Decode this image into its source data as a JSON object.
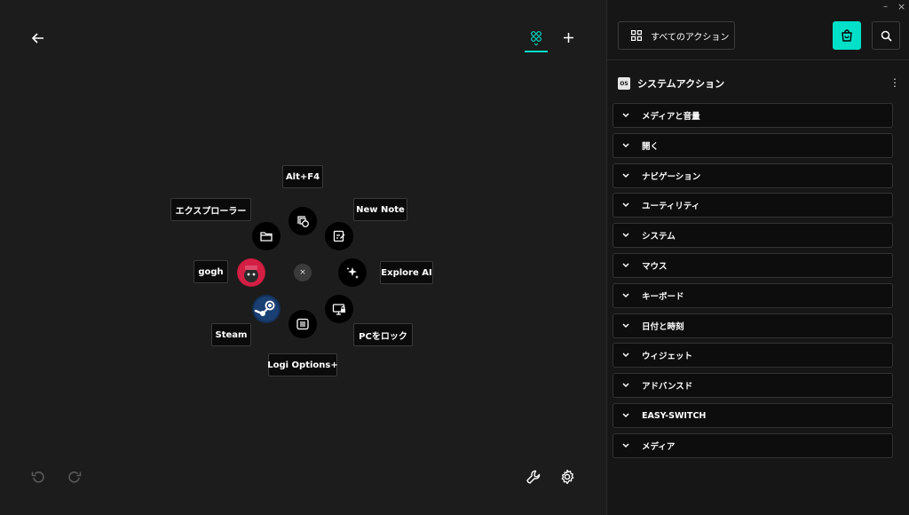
{
  "toolbar": {
    "back_icon": "arrow-left-icon",
    "layout_tab_icon": "grid-icon",
    "add_icon": "plus-icon"
  },
  "radial": {
    "center_close": "×",
    "items": [
      {
        "name": "alt-f4",
        "label": "Alt+F4",
        "icon": "close-window-icon"
      },
      {
        "name": "new-note",
        "label": "New Note",
        "icon": "edit-note-icon"
      },
      {
        "name": "explore-ai",
        "label": "Explore AI",
        "icon": "sparkle-icon"
      },
      {
        "name": "pc-lock",
        "label": "PCをロック",
        "icon": "monitor-lock-icon"
      },
      {
        "name": "logi-options",
        "label": "Logi Options+",
        "icon": "logi-app-icon"
      },
      {
        "name": "steam",
        "label": "Steam",
        "icon": "steam-icon"
      },
      {
        "name": "gogh",
        "label": "gogh",
        "icon": "gogh-app-icon"
      },
      {
        "name": "explorer",
        "label": "エクスプローラー",
        "icon": "folder-icon"
      }
    ]
  },
  "bottom": {
    "undo_icon": "undo-icon",
    "redo_icon": "redo-icon",
    "wrench_icon": "wrench-icon",
    "settings_icon": "gear-icon"
  },
  "panel": {
    "all_actions_label": "すべてのアクション",
    "section_badge": "OS",
    "section_title": "システムアクション",
    "categories": [
      "メディアと音量",
      "開く",
      "ナビゲーション",
      "ユーティリティ",
      "システム",
      "マウス",
      "キーボード",
      "日付と時刻",
      "ウィジェット",
      "アドバンスド",
      "EASY-SWITCH",
      "メディア"
    ]
  },
  "window": {
    "minimize": "–",
    "close": "×"
  },
  "colors": {
    "accent": "#00e0c8",
    "background": "#1c1c1c",
    "panel": "#161616"
  }
}
